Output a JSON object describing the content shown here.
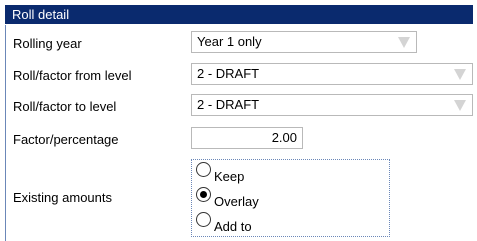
{
  "panel": {
    "title": "Roll detail"
  },
  "fields": {
    "rolling_year": {
      "label": "Rolling year",
      "value": "Year 1 only"
    },
    "from_level": {
      "label": "Roll/factor from level",
      "value": "2 - DRAFT"
    },
    "to_level": {
      "label": "Roll/factor to level",
      "value": "2 - DRAFT"
    },
    "factor": {
      "label": "Factor/percentage",
      "value": "2.00"
    },
    "existing": {
      "label": "Existing amounts",
      "options": [
        "Keep",
        "Overlay",
        "Add to"
      ],
      "selected": "Overlay"
    }
  },
  "icons": {
    "dropdown": "chevron-down-icon"
  },
  "colors": {
    "header_bg": "#0a2a6e",
    "header_text": "#ffffff"
  }
}
